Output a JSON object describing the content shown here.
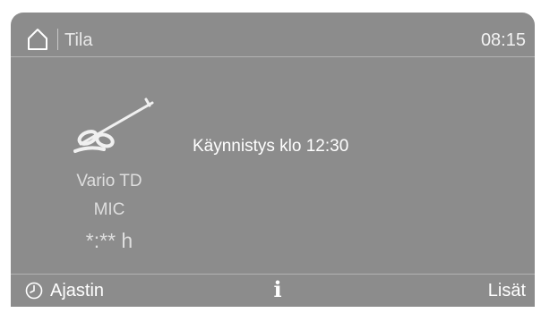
{
  "header": {
    "title": "Tila",
    "time": "08:15"
  },
  "program": {
    "icon": "vario-td-icon",
    "name_line1": "Vario TD",
    "name_line2": "MIC",
    "duration": "*:** h"
  },
  "status": {
    "message": "Käynnistys klo 12:30"
  },
  "footer": {
    "timer_label": "Ajastin",
    "info_symbol": "i",
    "more_label": "Lisät"
  },
  "colors": {
    "screen_bg": "#8c8c8c",
    "text_primary": "#ffffff",
    "text_secondary": "#dedede",
    "divider": "#b3b3b3"
  }
}
